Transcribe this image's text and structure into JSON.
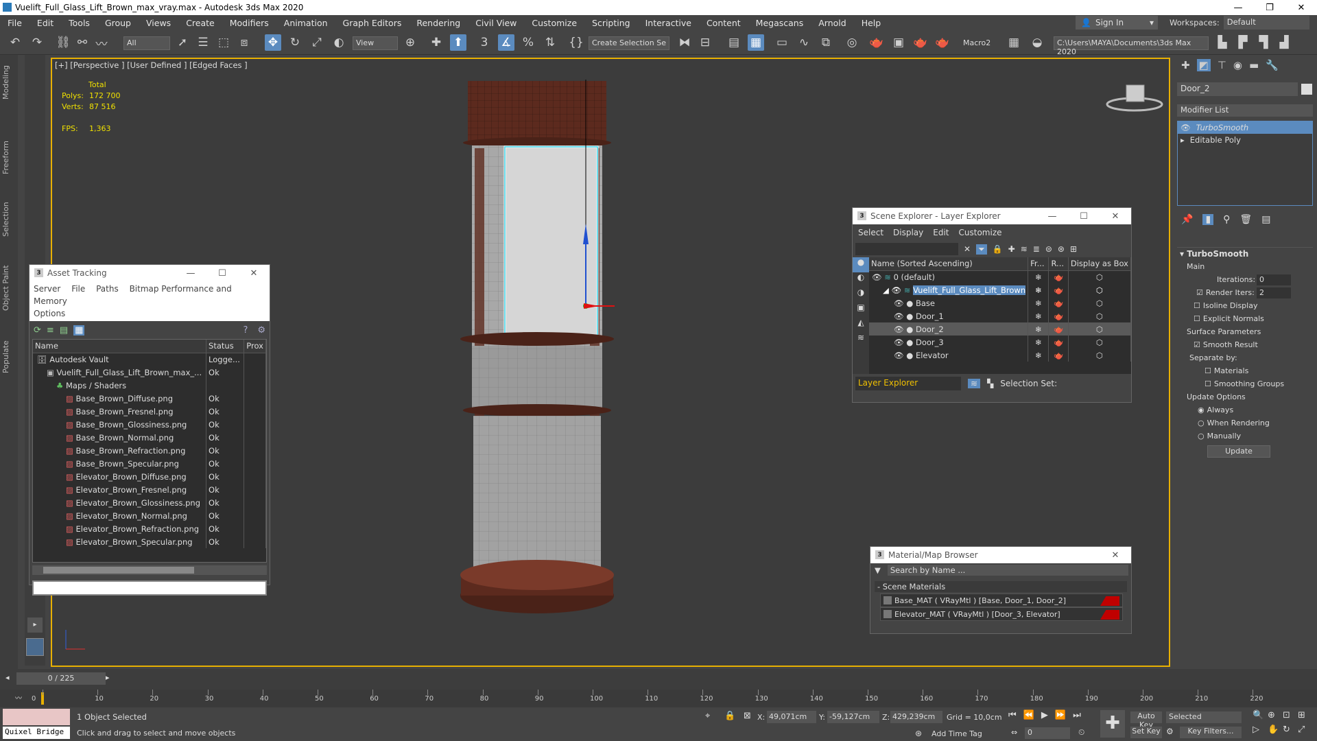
{
  "window": {
    "title": "Vuelift_Full_Glass_Lift_Brown_max_vray.max - Autodesk 3ds Max 2020"
  },
  "menu": [
    "File",
    "Edit",
    "Tools",
    "Group",
    "Views",
    "Create",
    "Modifiers",
    "Animation",
    "Graph Editors",
    "Rendering",
    "Civil View",
    "Customize",
    "Scripting",
    "Interactive",
    "Content",
    "Megascans",
    "Arnold",
    "Help"
  ],
  "account": {
    "signin": "Sign In",
    "workspaces_label": "Workspaces:",
    "workspace": "Default"
  },
  "toolbar": {
    "filter": "All",
    "refcoord": "View",
    "selection_set": "Create Selection Se",
    "macro": "Macro2",
    "path": "C:\\Users\\MAYA\\Documents\\3ds Max 2020"
  },
  "lefttabs": [
    "Modeling",
    "Freeform",
    "Selection",
    "Object Paint",
    "Populate"
  ],
  "viewport": {
    "label": "[+] [Perspective ] [User Defined ] [Edged Faces ]",
    "stats": {
      "total": "Total",
      "polys_label": "Polys:",
      "polys": "172 700",
      "verts_label": "Verts:",
      "verts": "87 516",
      "fps_label": "FPS:",
      "fps": "1,363"
    }
  },
  "command_panel": {
    "object_name": "Door_2",
    "modifier_list": "Modifier List",
    "stack": [
      "TurboSmooth",
      "Editable Poly"
    ],
    "turbosmooth": {
      "title": "TurboSmooth",
      "main": "Main",
      "iterations_label": "Iterations:",
      "iterations": "0",
      "render_iters_label": "Render Iters:",
      "render_iters": "2",
      "isoline": "Isoline Display",
      "explicit": "Explicit Normals",
      "surface": "Surface Parameters",
      "smooth_result": "Smooth Result",
      "separate": "Separate by:",
      "materials": "Materials",
      "smoothing": "Smoothing Groups",
      "update_options": "Update Options",
      "always": "Always",
      "when_rendering": "When Rendering",
      "manually": "Manually",
      "update_btn": "Update"
    }
  },
  "asset_tracking": {
    "title": "Asset Tracking",
    "menu": [
      "Server",
      "File",
      "Paths",
      "Bitmap Performance and Memory"
    ],
    "menu2": "Options",
    "columns": [
      "Name",
      "Status",
      "Prox"
    ],
    "rows": [
      {
        "name": "Autodesk Vault",
        "status": "Logge...",
        "indent": 0
      },
      {
        "name": "Vuelift_Full_Glass_Lift_Brown_max_...",
        "status": "Ok",
        "indent": 1
      },
      {
        "name": "Maps / Shaders",
        "status": "",
        "indent": 2
      },
      {
        "name": "Base_Brown_Diffuse.png",
        "status": "Ok",
        "indent": 3
      },
      {
        "name": "Base_Brown_Fresnel.png",
        "status": "Ok",
        "indent": 3
      },
      {
        "name": "Base_Brown_Glossiness.png",
        "status": "Ok",
        "indent": 3
      },
      {
        "name": "Base_Brown_Normal.png",
        "status": "Ok",
        "indent": 3
      },
      {
        "name": "Base_Brown_Refraction.png",
        "status": "Ok",
        "indent": 3
      },
      {
        "name": "Base_Brown_Specular.png",
        "status": "Ok",
        "indent": 3
      },
      {
        "name": "Elevator_Brown_Diffuse.png",
        "status": "Ok",
        "indent": 3
      },
      {
        "name": "Elevator_Brown_Fresnel.png",
        "status": "Ok",
        "indent": 3
      },
      {
        "name": "Elevator_Brown_Glossiness.png",
        "status": "Ok",
        "indent": 3
      },
      {
        "name": "Elevator_Brown_Normal.png",
        "status": "Ok",
        "indent": 3
      },
      {
        "name": "Elevator_Brown_Refraction.png",
        "status": "Ok",
        "indent": 3
      },
      {
        "name": "Elevator_Brown_Specular.png",
        "status": "Ok",
        "indent": 3
      }
    ]
  },
  "scene_explorer": {
    "title": "Scene Explorer - Layer Explorer",
    "menu": [
      "Select",
      "Display",
      "Edit",
      "Customize"
    ],
    "columns": [
      "Name (Sorted Ascending)",
      "Fr...",
      "R...",
      "Display as Box"
    ],
    "rows": [
      {
        "name": "0 (default)",
        "indent": 0,
        "selected": false
      },
      {
        "name": "Vuelift_Full_Glass_Lift_Brown",
        "indent": 1,
        "selected": false
      },
      {
        "name": "Base",
        "indent": 2,
        "selected": false
      },
      {
        "name": "Door_1",
        "indent": 2,
        "selected": false
      },
      {
        "name": "Door_2",
        "indent": 2,
        "selected": true
      },
      {
        "name": "Door_3",
        "indent": 2,
        "selected": false
      },
      {
        "name": "Elevator",
        "indent": 2,
        "selected": false
      }
    ],
    "footer_layer": "Layer Explorer",
    "footer_selset": "Selection Set:"
  },
  "material_browser": {
    "title": "Material/Map Browser",
    "search": "Search by Name ...",
    "group": "- Scene Materials",
    "items": [
      "Base_MAT ( VRayMtl ) [Base, Door_1, Door_2]",
      "Elevator_MAT ( VRayMtl ) [Door_3, Elevator]"
    ]
  },
  "timeline": {
    "frame": "0 / 225",
    "ticks": [
      "0",
      "10",
      "20",
      "30",
      "40",
      "50",
      "60",
      "70",
      "80",
      "90",
      "100",
      "110",
      "120",
      "130",
      "140",
      "150",
      "160",
      "170",
      "180",
      "190",
      "200",
      "210",
      "220"
    ]
  },
  "status": {
    "quixel": "Quixel Bridge",
    "selected": "1 Object Selected",
    "hint": "Click and drag to select and move objects",
    "x_label": "X:",
    "x": "49,071cm",
    "y_label": "Y:",
    "y": "-59,127cm",
    "z_label": "Z:",
    "z": "429,239cm",
    "grid": "Grid = 10,0cm",
    "add_time_tag": "Add Time Tag",
    "auto_key": "Auto Key",
    "set_key": "Set Key",
    "key_mode": "Selected",
    "key_filters": "Key Filters...",
    "frame_field": "0"
  }
}
